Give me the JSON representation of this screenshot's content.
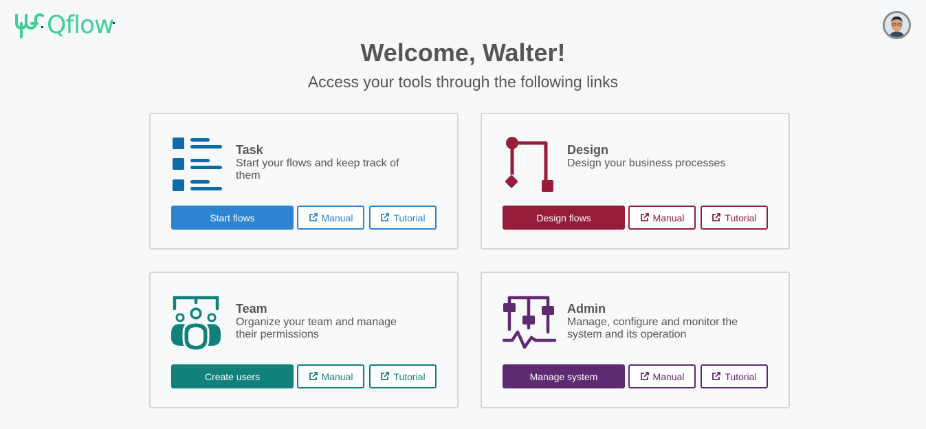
{
  "header": {
    "logo_text": "Qflow",
    "avatar_alt": "User avatar"
  },
  "welcome": {
    "title": "Welcome, Walter!",
    "subtitle": "Access your tools through the following links"
  },
  "colors": {
    "task": "#2d84d0",
    "task_icon": "#0e6aa8",
    "design": "#961d3a",
    "team": "#10827a",
    "admin": "#5e2a72",
    "logo": "#3ecf94"
  },
  "cards": [
    {
      "id": "task",
      "title": "Task",
      "description": "Start your flows and keep track of them",
      "primary_label": "Start flows",
      "manual_label": "Manual",
      "tutorial_label": "Tutorial",
      "icon": "task-list-icon"
    },
    {
      "id": "design",
      "title": "Design",
      "description": "Design your business processes",
      "primary_label": "Design flows",
      "manual_label": "Manual",
      "tutorial_label": "Tutorial",
      "icon": "process-diagram-icon"
    },
    {
      "id": "team",
      "title": "Team",
      "description": "Organize your team and manage their permissions",
      "primary_label": "Create users",
      "manual_label": "Manual",
      "tutorial_label": "Tutorial",
      "icon": "team-icon"
    },
    {
      "id": "admin",
      "title": "Admin",
      "description": "Manage, configure and monitor the system and its operation",
      "primary_label": "Manage system",
      "manual_label": "Manual",
      "tutorial_label": "Tutorial",
      "icon": "admin-sliders-icon"
    }
  ]
}
